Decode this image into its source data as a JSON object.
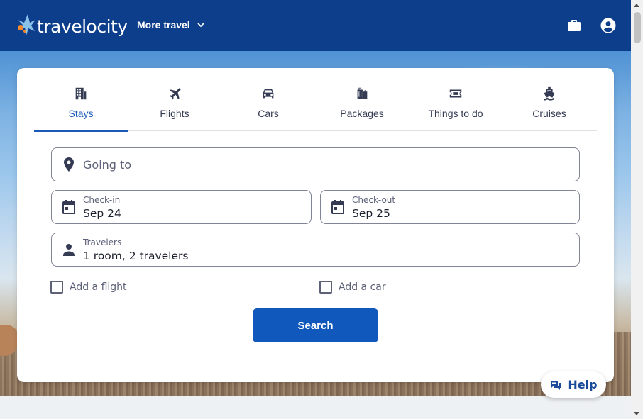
{
  "header": {
    "logo_text": "travelocity",
    "more_travel_label": "More travel",
    "trips_icon": "briefcase-icon",
    "account_icon": "account-circle-icon",
    "background_color": "#0c3e8c"
  },
  "tabs": [
    {
      "label": "Stays",
      "icon": "hotel-building-icon",
      "active": true
    },
    {
      "label": "Flights",
      "icon": "airplane-icon",
      "active": false
    },
    {
      "label": "Cars",
      "icon": "car-icon",
      "active": false
    },
    {
      "label": "Packages",
      "icon": "luggage-icon",
      "active": false
    },
    {
      "label": "Things to do",
      "icon": "ticket-icon",
      "active": false
    },
    {
      "label": "Cruises",
      "icon": "ship-icon",
      "active": false
    }
  ],
  "search": {
    "destination_placeholder": "Going to",
    "checkin_label": "Check-in",
    "checkin_value": "Sep 24",
    "checkout_label": "Check-out",
    "checkout_value": "Sep 25",
    "travelers_label": "Travelers",
    "travelers_value": "1 room, 2 travelers",
    "add_flight_label": "Add a flight",
    "add_car_label": "Add a car",
    "search_button_label": "Search"
  },
  "help": {
    "label": "Help"
  },
  "colors": {
    "accent": "#1058bc",
    "active_tab": "#1a59b8"
  }
}
